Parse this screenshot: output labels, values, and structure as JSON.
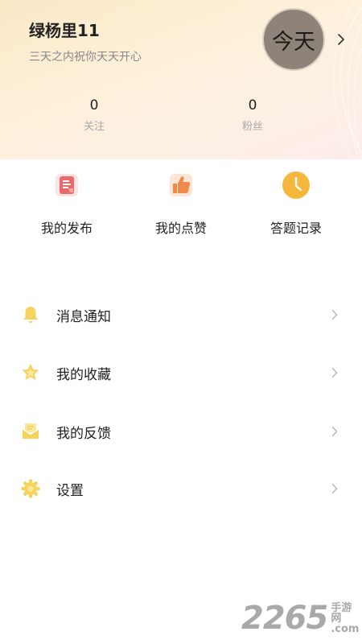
{
  "profile": {
    "username": "绿杨里11",
    "motto": "三天之内祝你天天开心",
    "avatar_text": "今天"
  },
  "stats": {
    "follow_count": "0",
    "follow_label": "关注",
    "fans_count": "0",
    "fans_label": "粉丝"
  },
  "quick_actions": [
    {
      "label": "我的发布",
      "icon": "document-icon",
      "color": "#e86b6b"
    },
    {
      "label": "我的点赞",
      "icon": "thumbs-up-icon",
      "color": "#f08a4b"
    },
    {
      "label": "答题记录",
      "icon": "clock-icon",
      "color": "#f5b83d"
    }
  ],
  "menu": [
    {
      "label": "消息通知",
      "icon": "bell-icon"
    },
    {
      "label": "我的收藏",
      "icon": "star-icon"
    },
    {
      "label": "我的反馈",
      "icon": "envelope-icon"
    },
    {
      "label": "设置",
      "icon": "gear-icon"
    }
  ],
  "watermark": {
    "number": "2265",
    "cn": "手游网",
    "en": ".com"
  },
  "colors": {
    "accent_yellow": "#f6d35c",
    "header_gradient_start": "#fbe9c6",
    "header_gradient_end": "#fbecea"
  }
}
